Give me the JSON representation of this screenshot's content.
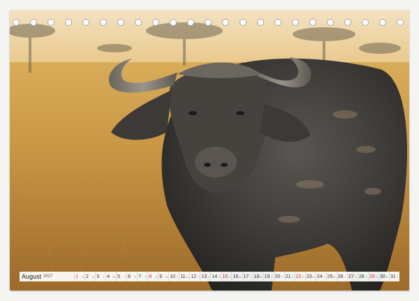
{
  "calendar": {
    "month": "August",
    "year": "2027",
    "days": [
      {
        "num": "1",
        "dow": "S",
        "type": "holiday"
      },
      {
        "num": "2",
        "dow": "M",
        "type": "normal"
      },
      {
        "num": "3",
        "dow": "T",
        "type": "normal"
      },
      {
        "num": "4",
        "dow": "W",
        "type": "normal"
      },
      {
        "num": "5",
        "dow": "T",
        "type": "normal"
      },
      {
        "num": "6",
        "dow": "F",
        "type": "normal"
      },
      {
        "num": "7",
        "dow": "S",
        "type": "weekend"
      },
      {
        "num": "8",
        "dow": "S",
        "type": "holiday"
      },
      {
        "num": "9",
        "dow": "M",
        "type": "normal"
      },
      {
        "num": "10",
        "dow": "T",
        "type": "normal"
      },
      {
        "num": "11",
        "dow": "W",
        "type": "normal"
      },
      {
        "num": "12",
        "dow": "T",
        "type": "normal"
      },
      {
        "num": "13",
        "dow": "F",
        "type": "normal"
      },
      {
        "num": "14",
        "dow": "S",
        "type": "weekend"
      },
      {
        "num": "15",
        "dow": "S",
        "type": "holiday"
      },
      {
        "num": "16",
        "dow": "M",
        "type": "normal"
      },
      {
        "num": "17",
        "dow": "T",
        "type": "normal"
      },
      {
        "num": "18",
        "dow": "W",
        "type": "normal"
      },
      {
        "num": "19",
        "dow": "T",
        "type": "normal"
      },
      {
        "num": "20",
        "dow": "F",
        "type": "normal"
      },
      {
        "num": "21",
        "dow": "S",
        "type": "weekend"
      },
      {
        "num": "22",
        "dow": "S",
        "type": "holiday"
      },
      {
        "num": "23",
        "dow": "M",
        "type": "normal"
      },
      {
        "num": "24",
        "dow": "T",
        "type": "normal"
      },
      {
        "num": "25",
        "dow": "W",
        "type": "normal"
      },
      {
        "num": "26",
        "dow": "T",
        "type": "normal"
      },
      {
        "num": "27",
        "dow": "F",
        "type": "normal"
      },
      {
        "num": "28",
        "dow": "S",
        "type": "weekend"
      },
      {
        "num": "29",
        "dow": "S",
        "type": "holiday"
      },
      {
        "num": "30",
        "dow": "M",
        "type": "normal"
      },
      {
        "num": "31",
        "dow": "T",
        "type": "normal"
      }
    ]
  },
  "binding": {
    "hole_count": 23
  },
  "colors": {
    "holiday": "#d0342c",
    "weekend_bg": "#eef6ee",
    "savanna_light": "#e8c77a",
    "savanna_dark": "#a8772e",
    "buffalo": "#3b3a38"
  }
}
